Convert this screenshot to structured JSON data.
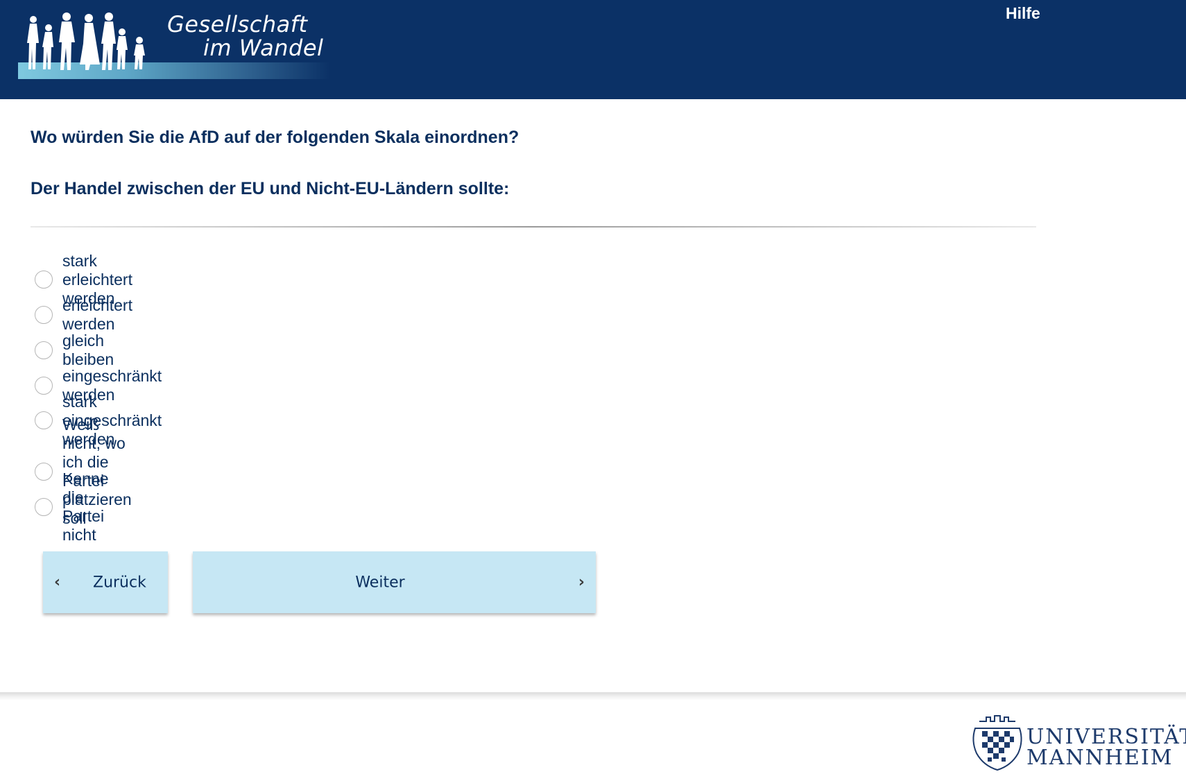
{
  "header": {
    "logo_text_line1": "Gesellschaft",
    "logo_text_line2": "im Wandel",
    "help_label": "Hilfe",
    "background_color": "#0b3166"
  },
  "question": {
    "title": "Wo würden Sie die AfD auf der folgenden Skala einordnen?",
    "subtitle": "Der Handel zwischen der EU und Nicht-EU-Ländern sollte:"
  },
  "options": [
    {
      "label": "stark erleichtert werden",
      "selected": false
    },
    {
      "label": "erleichtert werden",
      "selected": false
    },
    {
      "label": "gleich bleiben",
      "selected": false
    },
    {
      "label": "eingeschränkt werden",
      "selected": false
    },
    {
      "label": "stark eingeschränkt werden",
      "selected": false
    },
    {
      "label": "Weiß nicht, wo ich die Partei platzieren soll",
      "selected": false
    },
    {
      "label": "Kenne die Partei nicht",
      "selected": false
    }
  ],
  "navigation": {
    "back_label": "Zurück",
    "next_label": "Weiter",
    "button_color": "#c6e7f4"
  },
  "footer": {
    "university_line1": "UNIVERSITÄT",
    "university_line2": "MANNHEIM"
  }
}
